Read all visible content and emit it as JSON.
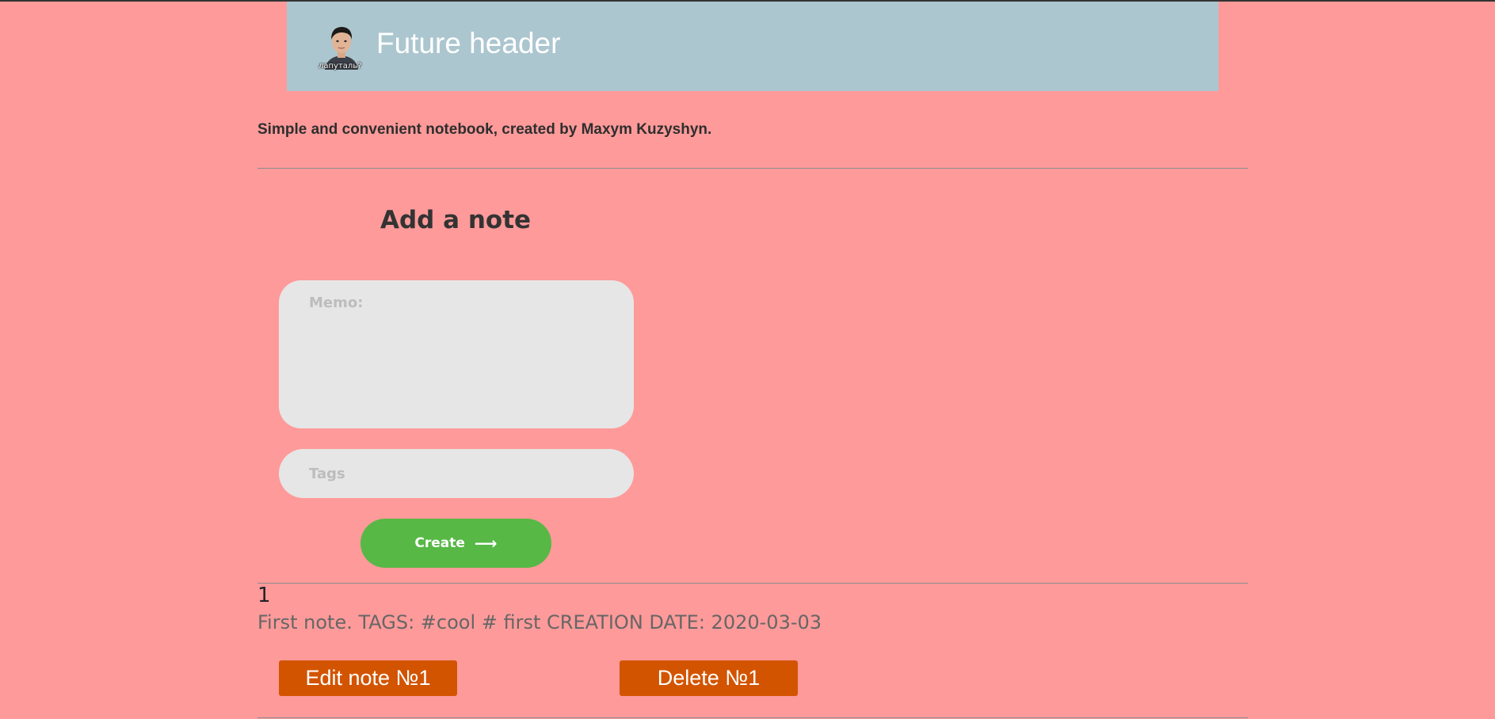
{
  "header": {
    "title": "Future header",
    "avatar_caption": "лапуталь?"
  },
  "tagline": "Simple and convenient notebook, created by Maxym Kuzyshyn.",
  "form": {
    "title": "Add a note",
    "memo_placeholder": "Memo:",
    "memo_value": "",
    "tags_placeholder": "Tags",
    "tags_value": "",
    "create_label": "Create",
    "create_icon": "arrow-right-icon"
  },
  "notes": [
    {
      "number": "1",
      "text": "First note. TAGS: #cool # first CREATION DATE: 2020-03-03",
      "edit_label": "Edit note №1",
      "delete_label": "Delete №1"
    }
  ],
  "colors": {
    "background": "#ff9a9a",
    "header": "#acc6cf",
    "create_button": "#57b846",
    "action_button": "#d35400",
    "input": "#e6e6e6"
  }
}
